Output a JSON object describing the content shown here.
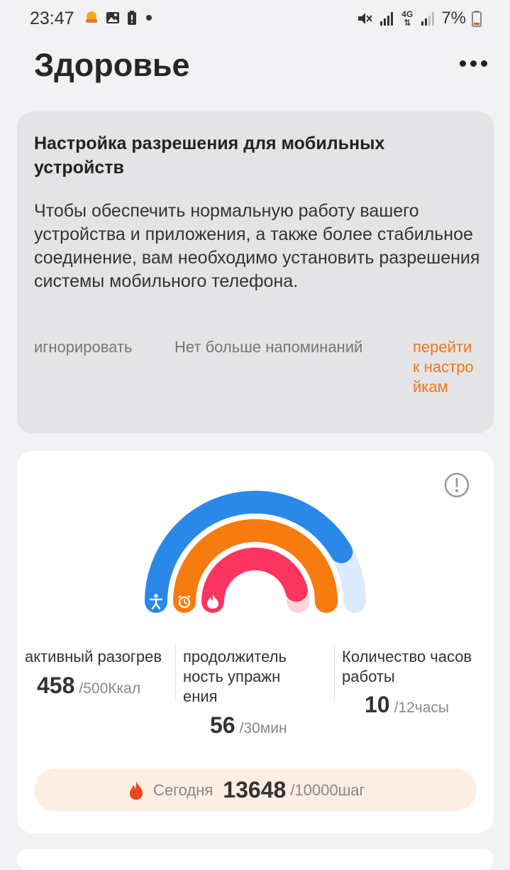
{
  "status_bar": {
    "time": "23:47",
    "left_icons": [
      "basket-icon",
      "image-icon",
      "battery-alert-icon",
      "dot-icon"
    ],
    "right_icons": [
      "mute-icon",
      "signal-icon",
      "4g-icon",
      "signal-icon"
    ],
    "network": "4G",
    "battery": "7%"
  },
  "header": {
    "title": "Здоровье",
    "more_icon": "more-icon"
  },
  "permission_card": {
    "title": "Настройка разрешения для мобильных устройств",
    "body": "Чтобы обеспечить нормальную работу вашего устройства и приложения, а также более стабильное соединение, вам необходимо установить разрешения системы мобильного телефона.",
    "ignore_label": "игнорировать",
    "no_more_label": "Нет больше напоминаний",
    "goto_label": "перейти к настройкам"
  },
  "activity": {
    "info_icon": "info-icon",
    "rings": [
      {
        "name": "Количество часов работы",
        "value": 10,
        "goal": 12,
        "color": "#2a88e8",
        "track": "#dcebfb",
        "icon": "standing-person-icon"
      },
      {
        "name": "продолжительность упражнения",
        "value": 56,
        "goal": 30,
        "color": "#f77b0e",
        "track": "#fde3cc",
        "icon": "alarm-clock-icon"
      },
      {
        "name": "активный разогрев",
        "value": 458,
        "goal": 500,
        "color": "#fb355f",
        "track": "#fdd4dc",
        "icon": "flame-icon"
      }
    ],
    "stats": {
      "calories": {
        "label": "активный разогрев",
        "value": "458",
        "goal": "/500Ккал"
      },
      "exercise": {
        "label": "продолжительность упражнения",
        "value": "56",
        "goal": "/30мин"
      },
      "hours": {
        "label": "Количество часов работы",
        "value": "10",
        "goal": "/12часы"
      }
    },
    "steps": {
      "label": "Сегодня",
      "value": "13648",
      "goal": "/10000шаг",
      "icon": "flame-icon",
      "color": "#f0461e"
    }
  }
}
